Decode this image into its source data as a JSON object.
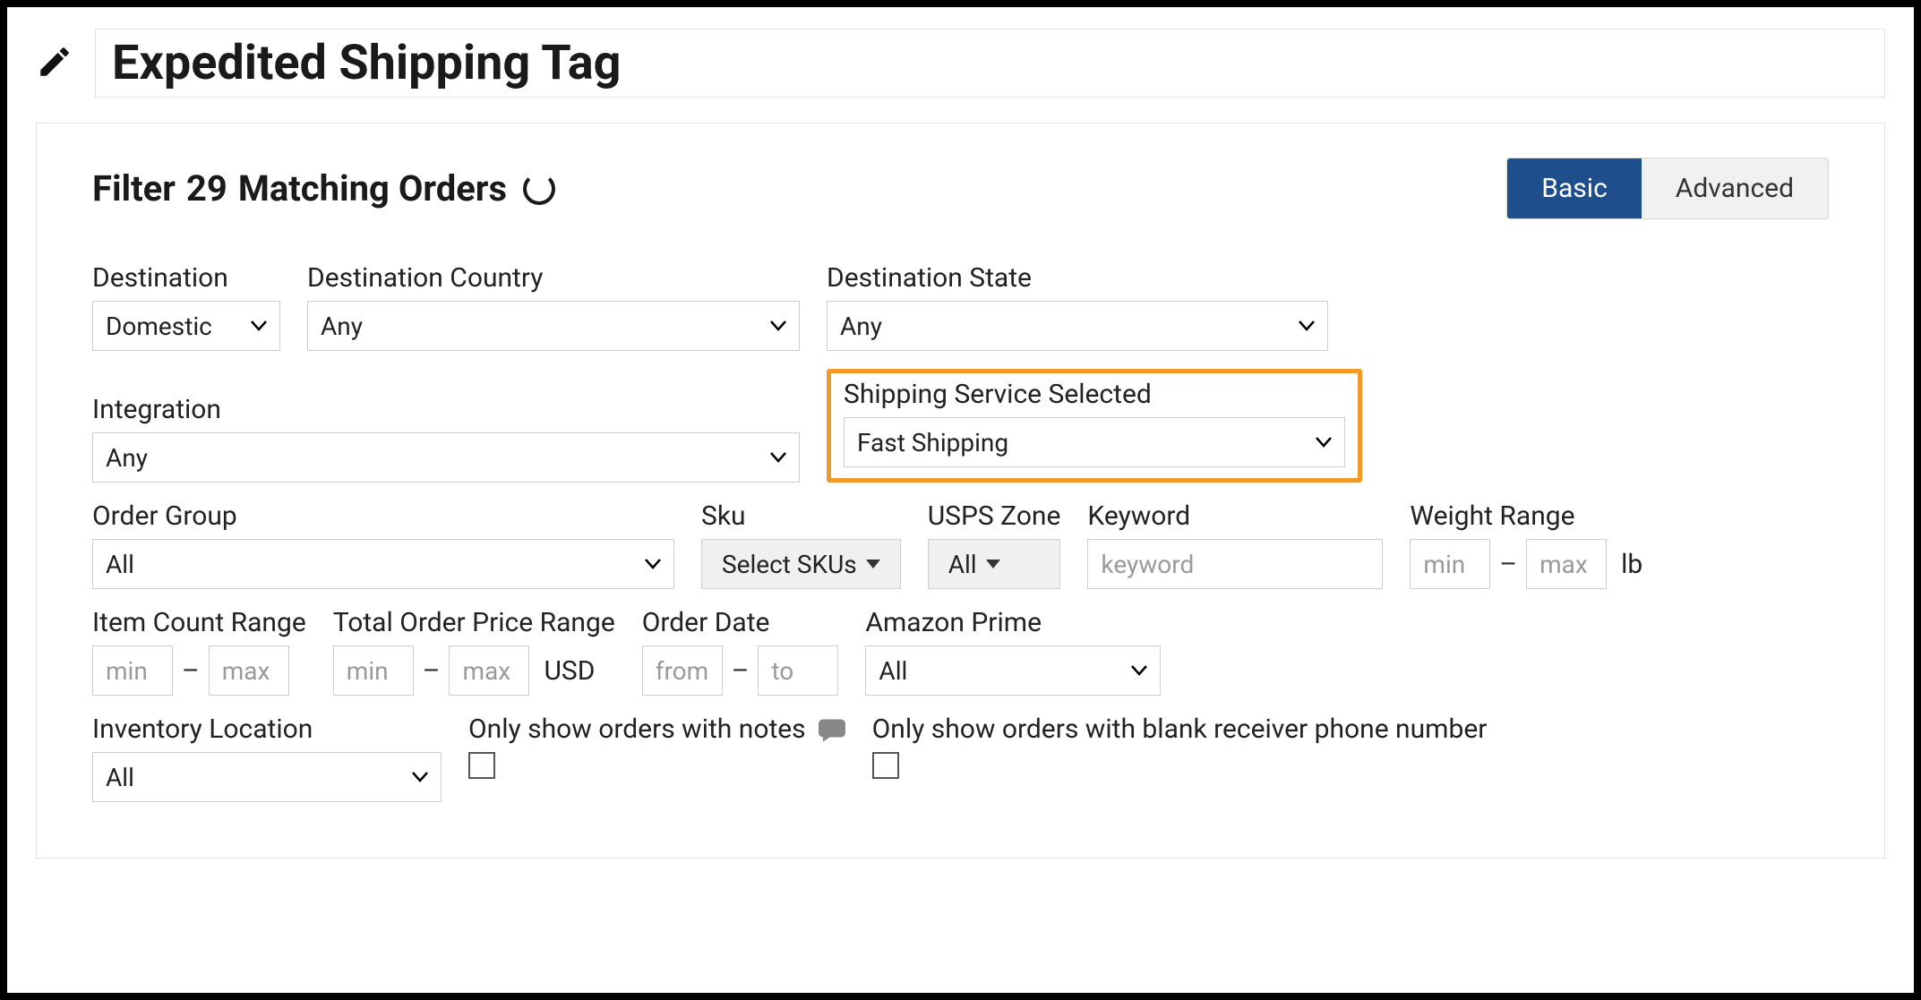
{
  "title": "Expedited Shipping Tag",
  "filter": {
    "heading_prefix": "Filter",
    "match_count": "29",
    "heading_suffix": "Matching Orders"
  },
  "mode": {
    "basic": "Basic",
    "advanced": "Advanced",
    "active": "basic"
  },
  "fields": {
    "destination": {
      "label": "Destination",
      "value": "Domestic"
    },
    "destination_country": {
      "label": "Destination Country",
      "value": "Any"
    },
    "destination_state": {
      "label": "Destination State",
      "value": "Any"
    },
    "integration": {
      "label": "Integration",
      "value": "Any"
    },
    "shipping_service": {
      "label": "Shipping Service Selected",
      "value": "Fast Shipping"
    },
    "order_group": {
      "label": "Order Group",
      "value": "All"
    },
    "sku": {
      "label": "Sku",
      "button": "Select SKUs"
    },
    "usps_zone": {
      "label": "USPS Zone",
      "button": "All"
    },
    "keyword": {
      "label": "Keyword",
      "placeholder": "keyword"
    },
    "weight_range": {
      "label": "Weight Range",
      "min_ph": "min",
      "max_ph": "max",
      "unit": "lb"
    },
    "item_count_range": {
      "label": "Item Count Range",
      "min_ph": "min",
      "max_ph": "max"
    },
    "total_price_range": {
      "label": "Total Order Price Range",
      "min_ph": "min",
      "max_ph": "max",
      "unit": "USD"
    },
    "order_date": {
      "label": "Order Date",
      "from_ph": "from",
      "to_ph": "to"
    },
    "amazon_prime": {
      "label": "Amazon Prime",
      "value": "All"
    },
    "inventory_location": {
      "label": "Inventory Location",
      "value": "All"
    },
    "only_notes": {
      "label": "Only show orders with notes"
    },
    "only_blank_phone": {
      "label": "Only show orders with blank receiver phone number"
    }
  }
}
